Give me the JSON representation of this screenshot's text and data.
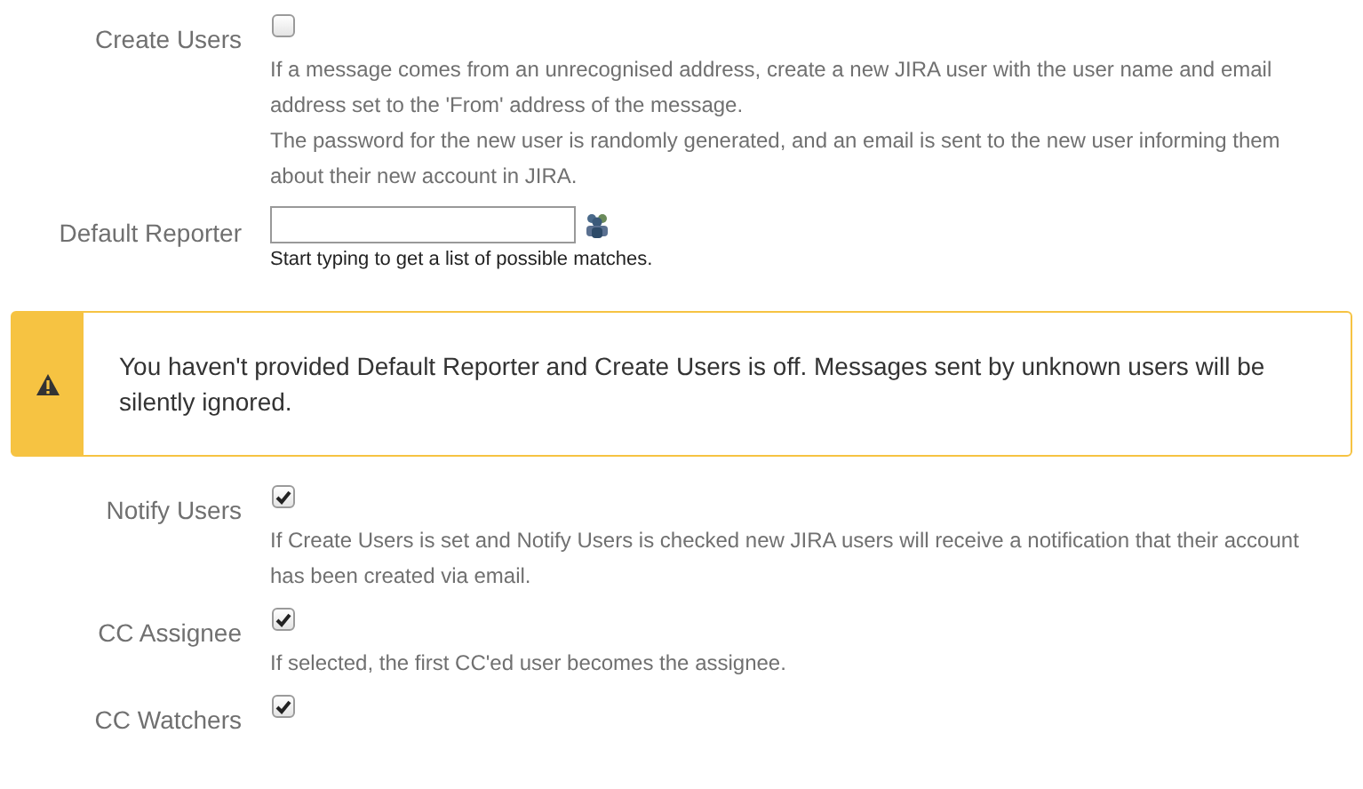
{
  "fields_top": [
    {
      "kind": "checkbox",
      "label": "Create Users",
      "checked": false,
      "descriptions": [
        "If a message comes from an unrecognised address, create a new JIRA user with the user name and email address set to the 'From' address of the message.",
        "The password for the new user is randomly generated, and an email is sent to the new user informing them about their new account in JIRA."
      ]
    },
    {
      "kind": "user-picker",
      "label": "Default Reporter",
      "hint": "Start typing to get a list of possible matches."
    }
  ],
  "warning": {
    "message": "You haven't provided Default Reporter and Create Users is off. Messages sent by unknown users will be silently ignored."
  },
  "fields_bottom": [
    {
      "kind": "checkbox",
      "label": "Notify Users",
      "checked": true,
      "descriptions": [
        "If Create Users is set and Notify Users is checked new JIRA users will receive a notification that their account has been created via email."
      ]
    },
    {
      "kind": "checkbox",
      "label": "CC Assignee",
      "checked": true,
      "descriptions": [
        "If selected, the first CC'ed user becomes the assignee."
      ]
    },
    {
      "kind": "checkbox",
      "label": "CC Watchers",
      "checked": true
    }
  ]
}
